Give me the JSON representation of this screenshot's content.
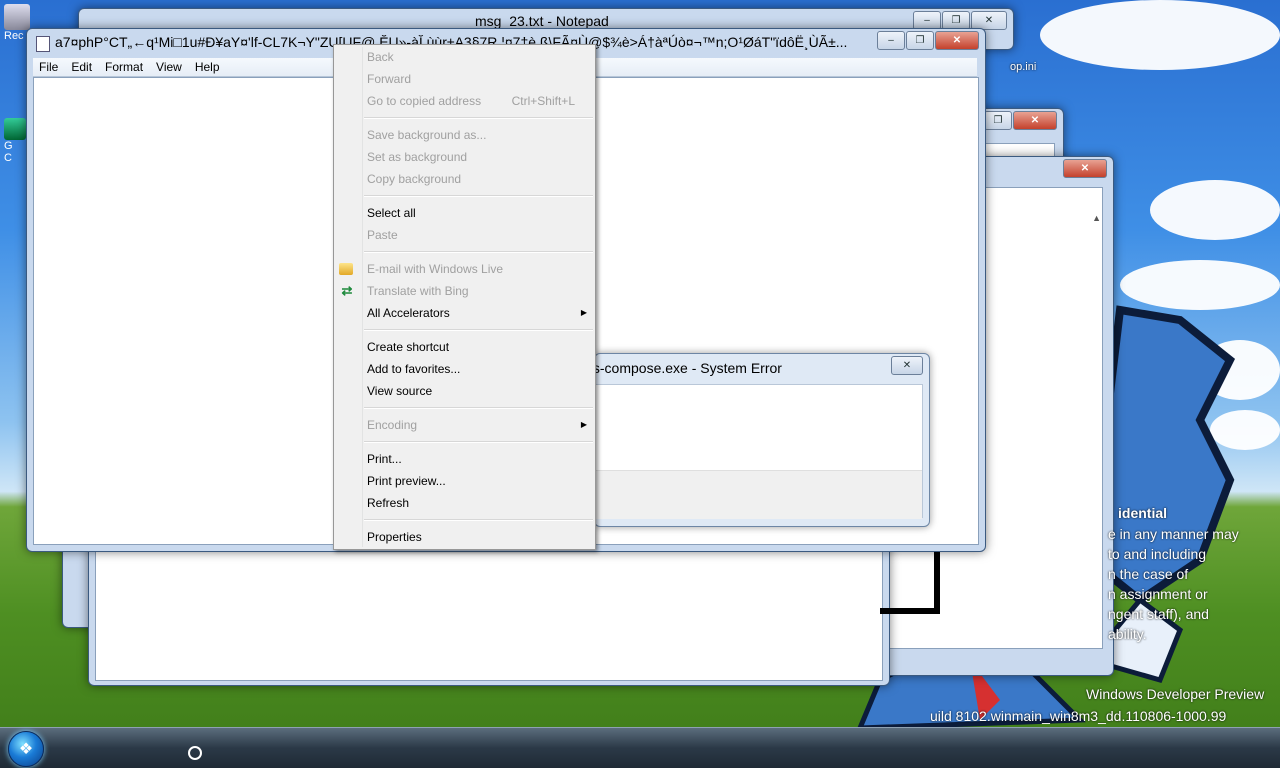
{
  "desktop": {
    "icon_labels": [
      "Rec",
      "G",
      "C"
    ],
    "right_file_label": "op.ini",
    "watermark": {
      "confidential_title": "idential",
      "confidential_lines": [
        "e in any manner may",
        "to and including",
        "n the case of",
        "n assignment or",
        "ngent staff), and",
        "ability."
      ],
      "build_line1": "Windows Developer Preview",
      "build_line2": "uild 8102.winmain_win8m3_dd.110806-1000.99"
    }
  },
  "back_notepad": {
    "title": "msg_23.txt - Notepad"
  },
  "notepad": {
    "title": "a7¤phP°CT„←q¹Mi□1u#Ð¥aY¤'lf-CL7K¬Y\"ZU[UF@  ĔU»‑àĬ  ùùr±A3§7R  ¦¤7†è  ß\\FÃ¤Ù@$¾è>Á†àªÚò¤¬™n;O¹ØáT\"ïdôË¸ÙÃ±...",
    "menu": [
      "File",
      "Edit",
      "Format",
      "View",
      "Help"
    ]
  },
  "context_menu": {
    "items": [
      {
        "label": "Back",
        "disabled": true
      },
      {
        "label": "Forward",
        "disabled": true
      },
      {
        "label": "Go to copied address",
        "shortcut": "Ctrl+Shift+L",
        "disabled": true
      },
      {
        "label": "Save background as...",
        "disabled": true
      },
      {
        "label": "Set as background",
        "disabled": true
      },
      {
        "label": "Copy background",
        "disabled": true
      },
      {
        "label": "Select all",
        "disabled": false
      },
      {
        "label": "Paste",
        "disabled": true
      },
      {
        "label": "E-mail with Windows Live",
        "disabled": true,
        "icon": "windows-live-mail-icon"
      },
      {
        "label": "Translate with Bing",
        "disabled": true,
        "icon": "bing-translate-icon"
      },
      {
        "label": "All Accelerators",
        "disabled": false,
        "submenu": true
      },
      {
        "label": "Create shortcut",
        "disabled": false
      },
      {
        "label": "Add to favorites...",
        "disabled": false
      },
      {
        "label": "View source",
        "disabled": false
      },
      {
        "label": "Encoding",
        "disabled": true,
        "submenu": true
      },
      {
        "label": "Print...",
        "disabled": false
      },
      {
        "label": "Print preview...",
        "disabled": false
      },
      {
        "label": "Refresh",
        "disabled": false
      },
      {
        "label": "Properties",
        "disabled": false
      }
    ]
  },
  "error_dialog": {
    "title": "fs-compose.exe - System Error"
  },
  "colors": {
    "sky": "#3f8fe6",
    "grass": "#4e8f22",
    "menu_bg": "#f0f0f0",
    "disabled_text": "#a0a0a0",
    "close_button": "#c4412c"
  }
}
